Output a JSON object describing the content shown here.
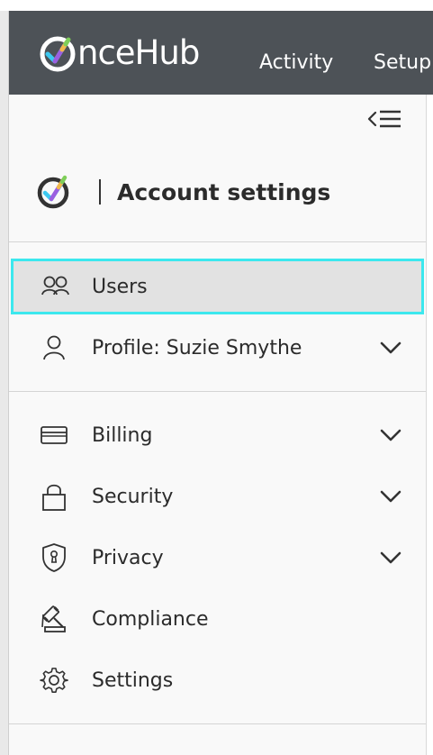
{
  "brand": {
    "logo_text": "nceHub",
    "logo_mark": "O-check-icon",
    "colors": {
      "topbar": "#4d5257",
      "active_border": "#3ce8ee",
      "active_bg": "#e2e2e2"
    }
  },
  "topnav": {
    "items": [
      {
        "label": "Activity"
      },
      {
        "label": "Setup"
      }
    ]
  },
  "sidebar": {
    "collapse_icon": "collapse-menu-icon",
    "header": {
      "title": "Account settings"
    },
    "items": [
      {
        "label": "Users",
        "icon": "users-icon",
        "active": true,
        "has_chevron": false
      },
      {
        "label": "Profile: Suzie Smythe",
        "icon": "user-icon",
        "active": false,
        "has_chevron": true
      },
      {
        "label": "Billing",
        "icon": "credit-card-icon",
        "active": false,
        "has_chevron": true
      },
      {
        "label": "Security",
        "icon": "lock-icon",
        "active": false,
        "has_chevron": true
      },
      {
        "label": "Privacy",
        "icon": "shield-icon",
        "active": false,
        "has_chevron": true
      },
      {
        "label": "Compliance",
        "icon": "gavel-icon",
        "active": false,
        "has_chevron": false
      },
      {
        "label": "Settings",
        "icon": "gear-icon",
        "active": false,
        "has_chevron": false
      }
    ]
  }
}
